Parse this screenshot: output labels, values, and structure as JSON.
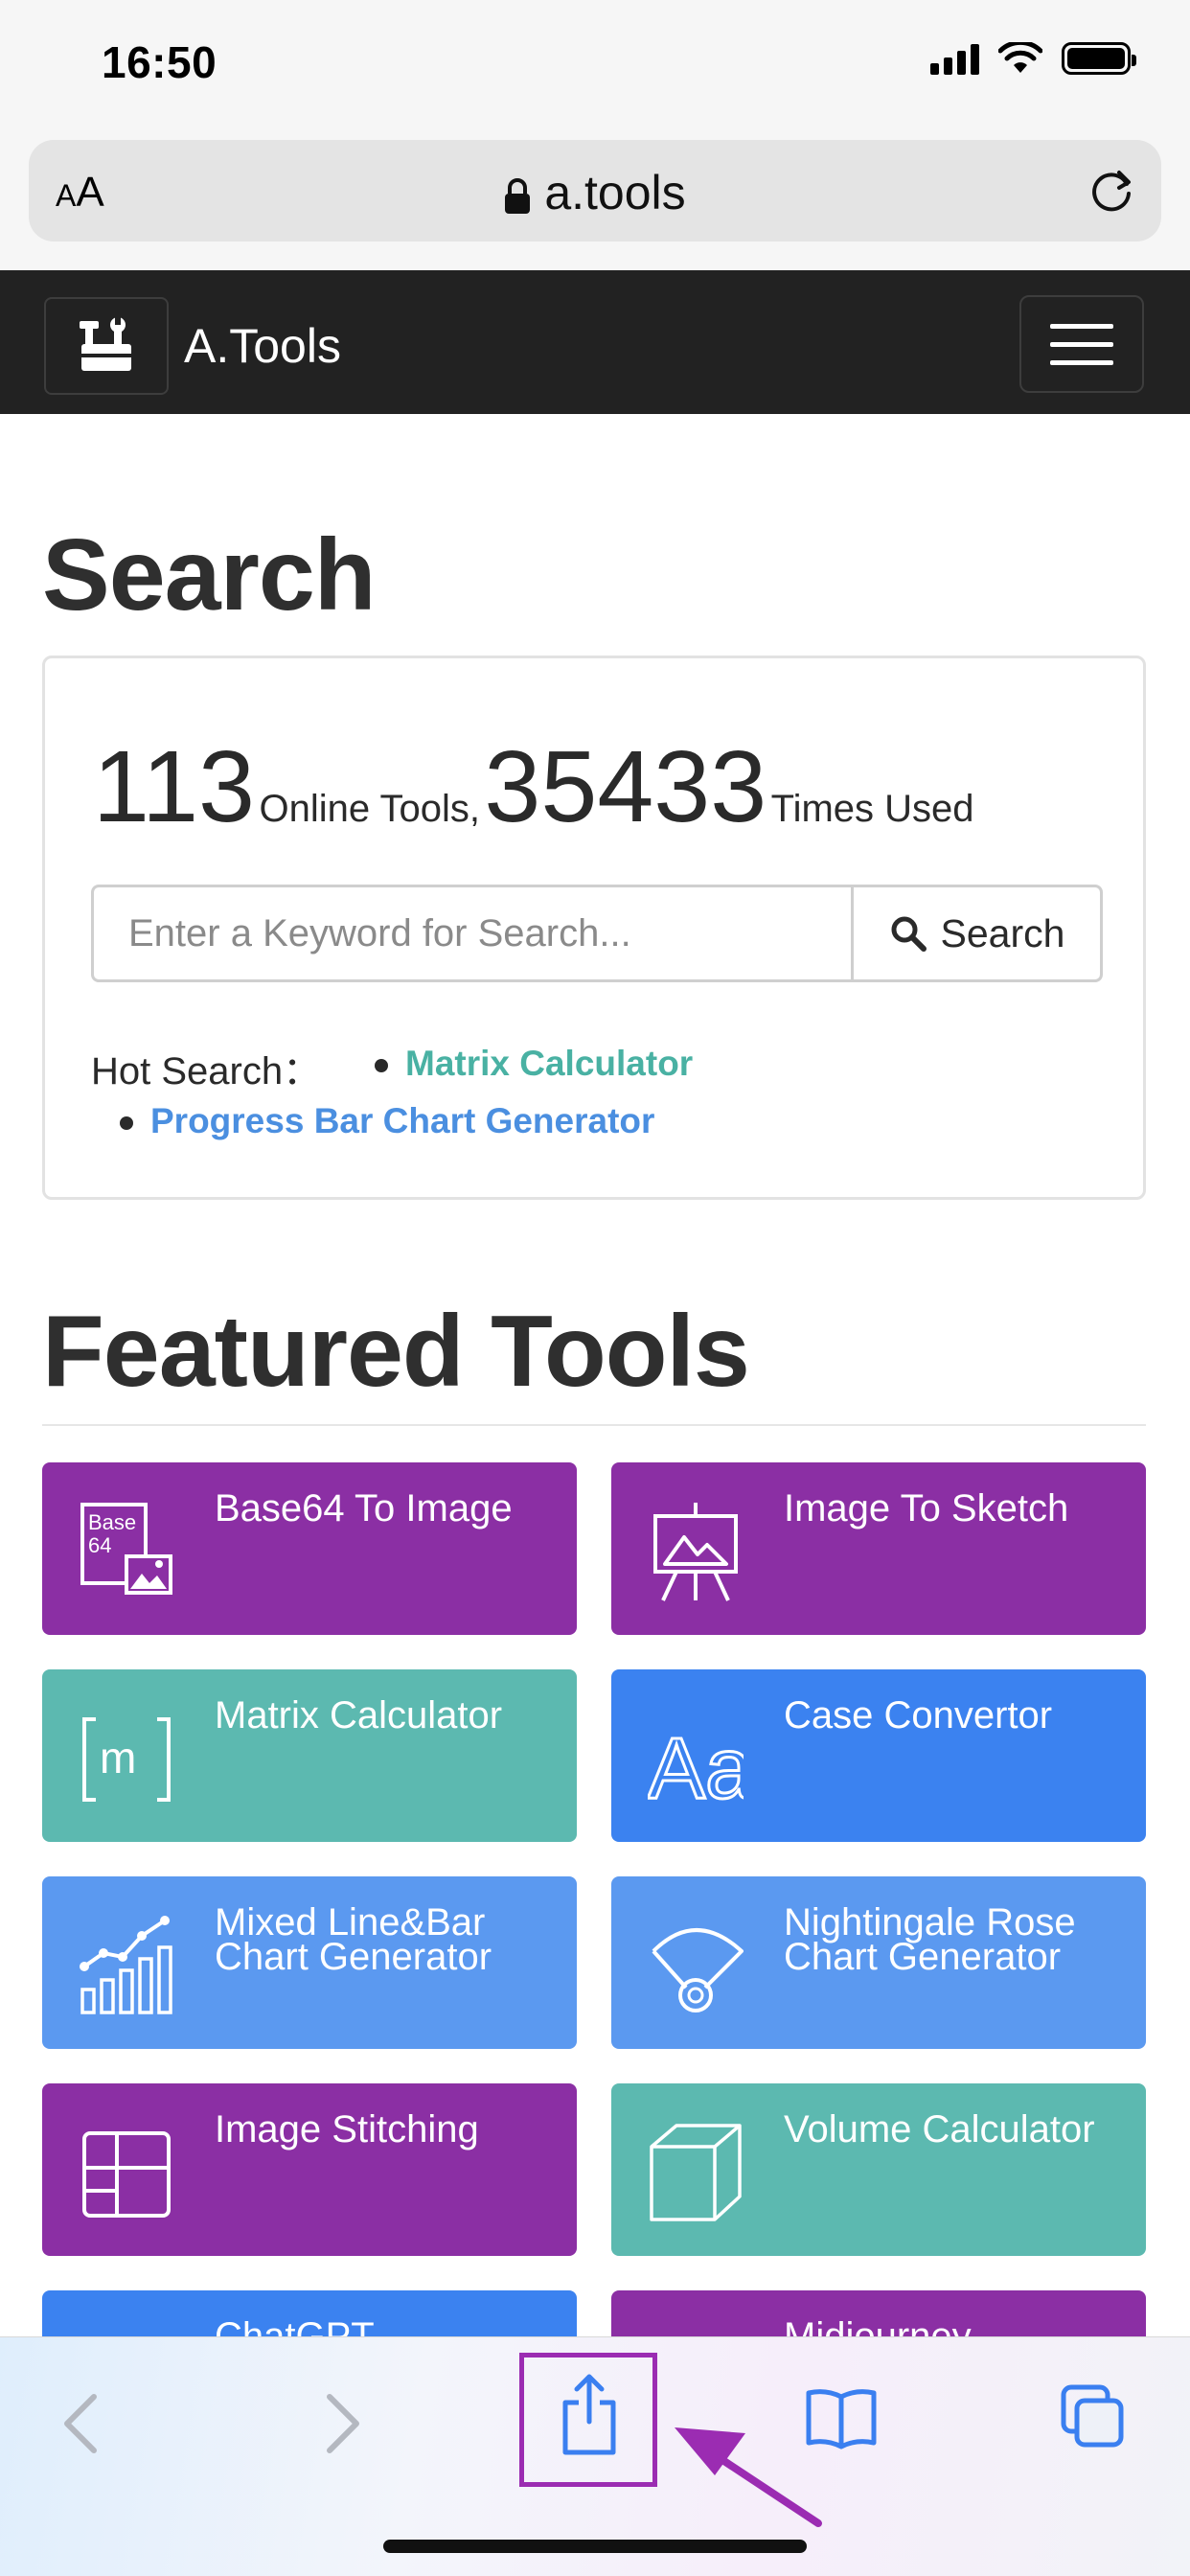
{
  "status_bar": {
    "time": "16:50"
  },
  "browser": {
    "text_size_button": "AA",
    "url": "a.tools"
  },
  "navbar": {
    "brand": "A.Tools"
  },
  "search": {
    "title": "Search",
    "tools_count": "113",
    "tools_label": "Online Tools,",
    "uses_count": "35433",
    "uses_label": "Times Used",
    "placeholder": "Enter a Keyword for Search...",
    "button_label": "Search",
    "hot_label": "Hot Search：",
    "hot_items": [
      "Matrix Calculator",
      "Progress Bar Chart Generator"
    ]
  },
  "featured": {
    "title": "Featured Tools",
    "tiles": [
      {
        "label": "Base64 To Image",
        "color": "#8b2fa4",
        "icon": "base64-image-icon"
      },
      {
        "label": "Image To Sketch",
        "color": "#8b2fa4",
        "icon": "easel-icon"
      },
      {
        "label": "Matrix Calculator",
        "color": "#5cb9b0",
        "icon": "matrix-icon"
      },
      {
        "label": "Case Convertor",
        "color": "#3b82f0",
        "icon": "case-aa-icon"
      },
      {
        "label": "Mixed Line&Bar Chart Generator",
        "color": "#5b99f0",
        "icon": "line-bar-chart-icon"
      },
      {
        "label": "Nightingale Rose Chart Generator",
        "color": "#5b99f0",
        "icon": "rose-chart-icon"
      },
      {
        "label": "Image Stitching",
        "color": "#8b2fa4",
        "icon": "grid-stitch-icon"
      },
      {
        "label": "Volume Calculator",
        "color": "#5cb9b0",
        "icon": "cube-icon"
      },
      {
        "label": "ChatGPT",
        "color": "#3b82f0",
        "icon": "chatgpt-icon"
      },
      {
        "label": "Midjourney",
        "color": "#8b2fa4",
        "icon": "midjourney-icon"
      }
    ]
  },
  "toolbar": {
    "buttons": [
      "back",
      "forward",
      "share",
      "bookmarks",
      "tabs"
    ],
    "highlighted": "share"
  },
  "colors": {
    "navbar": "#222222",
    "hot_matrix": "#49b1a3",
    "hot_progress": "#4b8fe0",
    "annotation": "#9b2cb2"
  }
}
